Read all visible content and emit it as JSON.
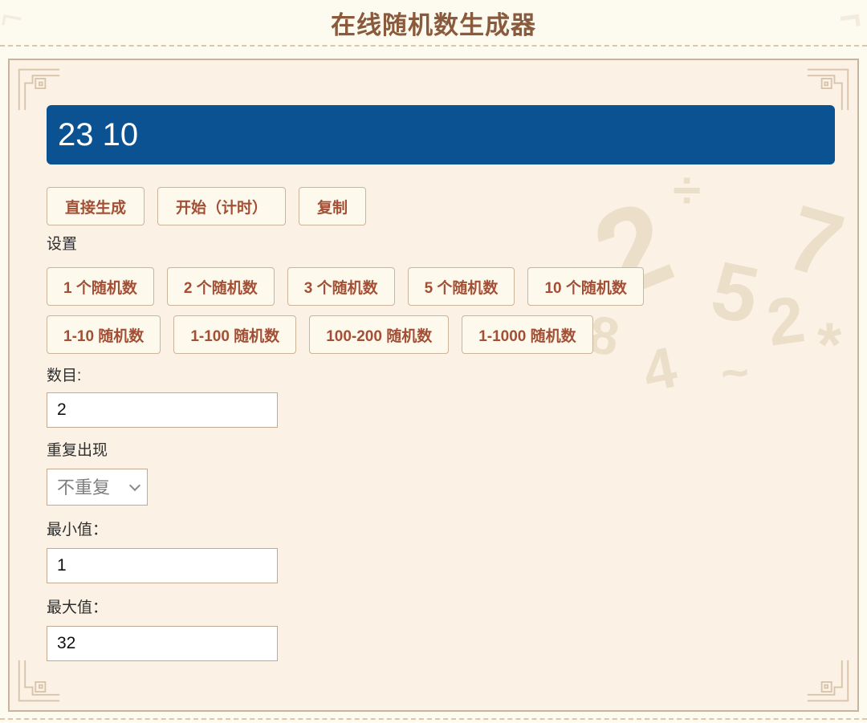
{
  "header": {
    "title": "在线随机数生成器"
  },
  "result": {
    "value": "23 10"
  },
  "actions": {
    "generate": "直接生成",
    "start_timed": "开始（计时）",
    "copy": "复制"
  },
  "settings": {
    "label": "设置",
    "count_presets": [
      "1 个随机数",
      "2 个随机数",
      "3 个随机数",
      "5 个随机数",
      "10 个随机数"
    ],
    "range_presets": [
      "1-10 随机数",
      "1-100 随机数",
      "100-200 随机数",
      "1-1000 随机数"
    ],
    "count_field": {
      "label": "数目:",
      "value": "2"
    },
    "repeat_field": {
      "label": "重复出现",
      "selected_option": "不重复"
    },
    "min_field": {
      "label": "最小值：",
      "value": "1"
    },
    "max_field": {
      "label": "最大值：",
      "value": "32"
    }
  },
  "colors": {
    "accent_blue": "#0a5292",
    "brand_brown": "#8a5a3c",
    "button_text": "#a34f35",
    "frame_background": "#fbf2e5"
  },
  "watermark": {
    "glyphs": [
      "2",
      "5",
      "7",
      "2",
      "÷",
      "*",
      "8",
      "4",
      "~"
    ]
  }
}
